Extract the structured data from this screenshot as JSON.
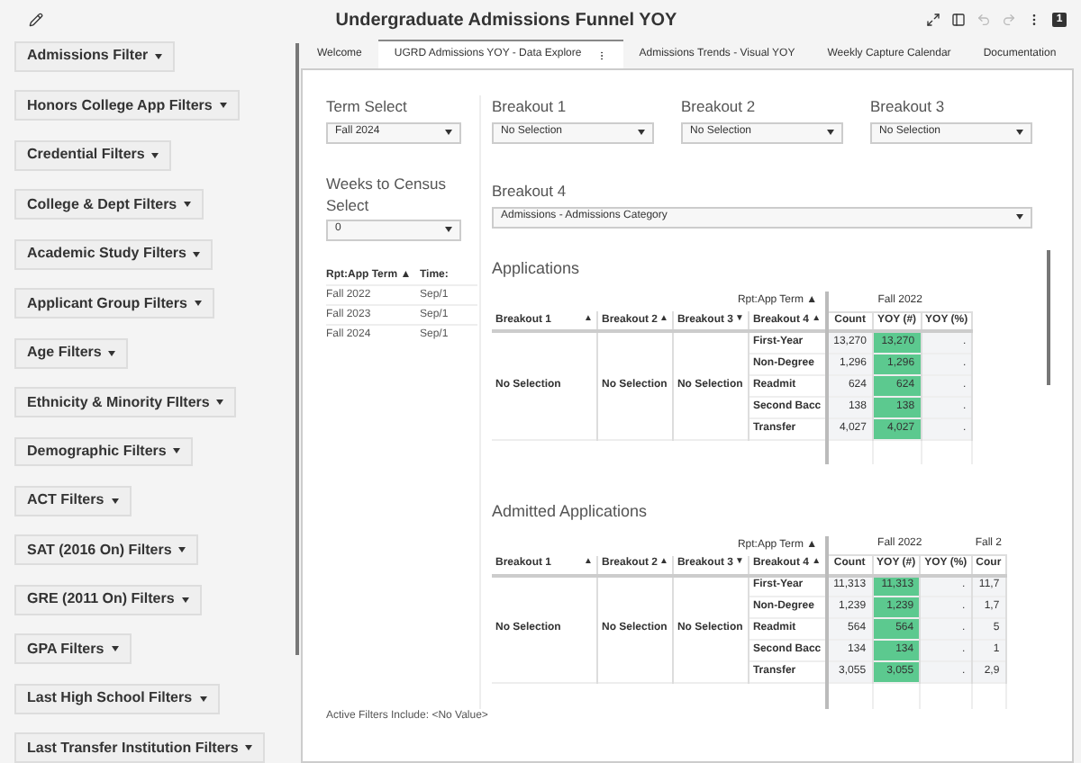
{
  "header": {
    "title": "Undergraduate Admissions Funnel YOY",
    "page_badge": "1"
  },
  "sidebar": {
    "filters": [
      "Admissions Filter",
      "Honors College App Filters",
      "Credential Filters",
      "College & Dept Filters",
      "Academic Study Filters",
      "Applicant Group Filters",
      "Age Filters",
      "Ethnicity & Minority FIlters",
      "Demographic Filters",
      "ACT Filters",
      "SAT (2016 On) Filters",
      "GRE (2011 On) Filters",
      "GPA Filters",
      "Last High School Filters",
      "Last Transfer Institution Filters"
    ]
  },
  "tabs": [
    {
      "label": "Welcome",
      "selected": false
    },
    {
      "label": "UGRD Admissions YOY - Data Explore",
      "selected": true
    },
    {
      "label": "Admissions Trends - Visual YOY",
      "selected": false
    },
    {
      "label": "Weekly Capture Calendar",
      "selected": false
    },
    {
      "label": "Documentation",
      "selected": false
    }
  ],
  "term_select": {
    "label": "Term Select",
    "value": "Fall 2024"
  },
  "weeks_select": {
    "label": "Weeks to Census Select",
    "value": "0"
  },
  "term_table": {
    "columns": [
      "Rpt:App Term ▲",
      "Time:"
    ],
    "rows": [
      [
        "Fall 2022",
        "Sep/1"
      ],
      [
        "Fall 2023",
        "Sep/1"
      ],
      [
        "Fall 2024",
        "Sep/1"
      ]
    ]
  },
  "breakouts": [
    {
      "label": "Breakout 1",
      "value": "No Selection"
    },
    {
      "label": "Breakout 2",
      "value": "No Selection"
    },
    {
      "label": "Breakout 3",
      "value": "No Selection"
    },
    {
      "label": "Breakout 4",
      "value": "Admissions - Admissions Category"
    }
  ],
  "tables": [
    {
      "title": "Applications",
      "term_header": "Rpt:App Term ▲",
      "groups": [
        {
          "label": "Fall 2022",
          "columns": [
            "Count",
            "YOY (#)",
            "YOY (%)"
          ]
        }
      ],
      "row_headers": [
        {
          "label": "Breakout 1",
          "sort": "▲"
        },
        {
          "label": "Breakout 2",
          "sort": "▲"
        },
        {
          "label": "Breakout 3",
          "sort": "▼"
        },
        {
          "label": "Breakout 4",
          "sort": "▲"
        }
      ],
      "group_values": [
        "No Selection",
        "No Selection",
        "No Selection"
      ],
      "rows": [
        {
          "category": "First-Year",
          "cells": [
            {
              "text": "13,270",
              "highlight": false
            },
            {
              "text": "13,270",
              "highlight": true
            },
            {
              "text": ".",
              "highlight": false
            }
          ]
        },
        {
          "category": "Non-Degree",
          "cells": [
            {
              "text": "1,296",
              "highlight": false
            },
            {
              "text": "1,296",
              "highlight": true
            },
            {
              "text": ".",
              "highlight": false
            }
          ]
        },
        {
          "category": "Readmit",
          "cells": [
            {
              "text": "624",
              "highlight": false
            },
            {
              "text": "624",
              "highlight": true
            },
            {
              "text": ".",
              "highlight": false
            }
          ]
        },
        {
          "category": "Second Bacc",
          "cells": [
            {
              "text": "138",
              "highlight": false
            },
            {
              "text": "138",
              "highlight": true
            },
            {
              "text": ".",
              "highlight": false
            }
          ]
        },
        {
          "category": "Transfer",
          "cells": [
            {
              "text": "4,027",
              "highlight": false
            },
            {
              "text": "4,027",
              "highlight": true
            },
            {
              "text": ".",
              "highlight": false
            }
          ]
        }
      ]
    },
    {
      "title": "Admitted Applications",
      "term_header": "Rpt:App Term ▲",
      "groups": [
        {
          "label": "Fall 2022",
          "columns": [
            "Count",
            "YOY (#)",
            "YOY (%)"
          ]
        },
        {
          "label": "Fall 2",
          "columns": [
            "Cour"
          ]
        }
      ],
      "row_headers": [
        {
          "label": "Breakout 1",
          "sort": "▲"
        },
        {
          "label": "Breakout 2",
          "sort": "▲"
        },
        {
          "label": "Breakout 3",
          "sort": "▼"
        },
        {
          "label": "Breakout 4",
          "sort": "▲"
        }
      ],
      "group_values": [
        "No Selection",
        "No Selection",
        "No Selection"
      ],
      "rows": [
        {
          "category": "First-Year",
          "cells": [
            {
              "text": "11,313",
              "highlight": false
            },
            {
              "text": "11,313",
              "highlight": true
            },
            {
              "text": ".",
              "highlight": false
            },
            {
              "text": "11,7",
              "highlight": false
            }
          ]
        },
        {
          "category": "Non-Degree",
          "cells": [
            {
              "text": "1,239",
              "highlight": false
            },
            {
              "text": "1,239",
              "highlight": true
            },
            {
              "text": ".",
              "highlight": false
            },
            {
              "text": "1,7",
              "highlight": false
            }
          ]
        },
        {
          "category": "Readmit",
          "cells": [
            {
              "text": "564",
              "highlight": false
            },
            {
              "text": "564",
              "highlight": true
            },
            {
              "text": ".",
              "highlight": false
            },
            {
              "text": "5",
              "highlight": false
            }
          ]
        },
        {
          "category": "Second Bacc",
          "cells": [
            {
              "text": "134",
              "highlight": false
            },
            {
              "text": "134",
              "highlight": true
            },
            {
              "text": ".",
              "highlight": false
            },
            {
              "text": "1",
              "highlight": false
            }
          ]
        },
        {
          "category": "Transfer",
          "cells": [
            {
              "text": "3,055",
              "highlight": false
            },
            {
              "text": "3,055",
              "highlight": true
            },
            {
              "text": ".",
              "highlight": false
            },
            {
              "text": "2,9",
              "highlight": false
            }
          ]
        }
      ]
    }
  ],
  "active_filters": "Active Filters Include: <No Value>"
}
